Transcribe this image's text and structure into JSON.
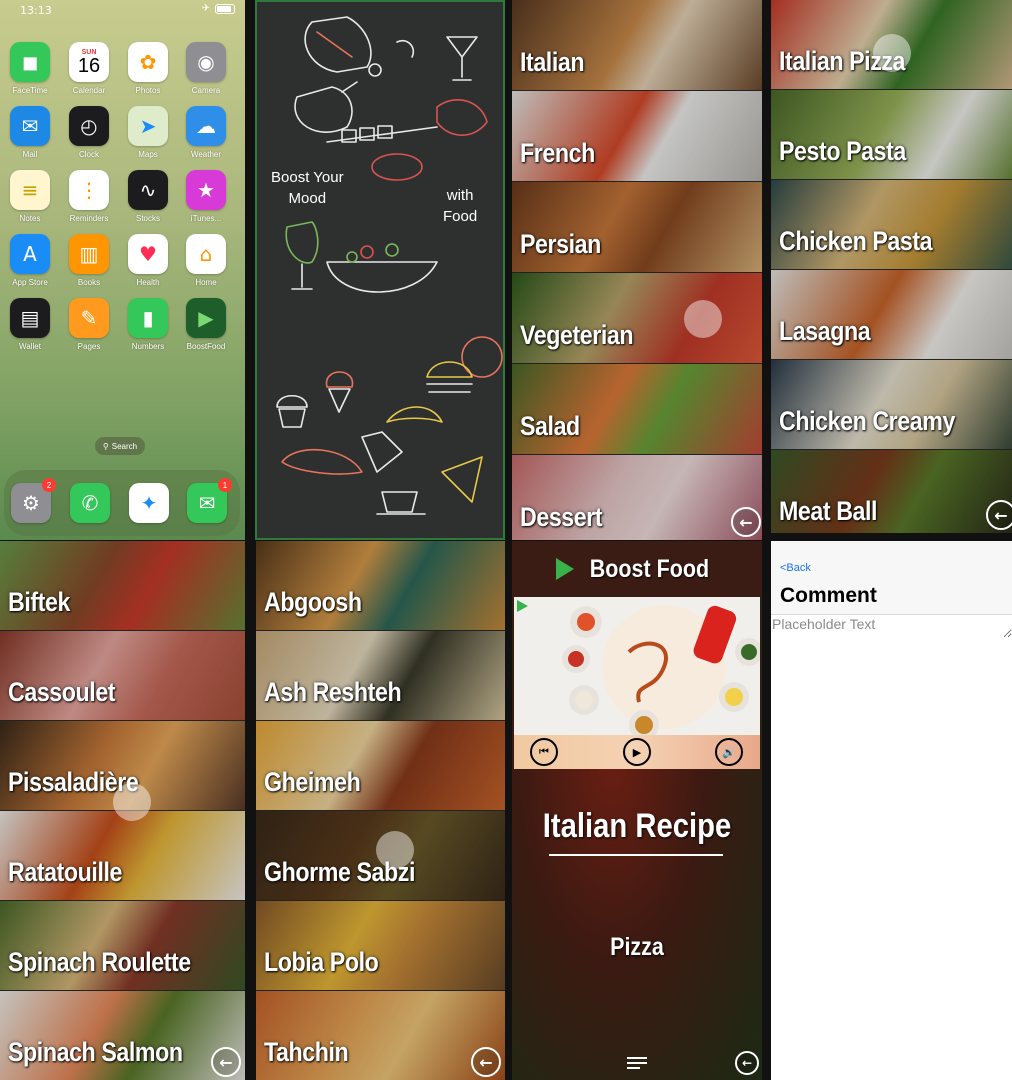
{
  "home": {
    "time": "13:13",
    "calendar_day": "SUN",
    "calendar_date": "16",
    "apps": [
      {
        "label": "FaceTime",
        "color": "#34c759",
        "icon": "video-icon",
        "glyph": "◼"
      },
      {
        "label": "Calendar",
        "color": "#ffffff",
        "icon": "calendar-icon",
        "glyph": ""
      },
      {
        "label": "Photos",
        "color": "#ffffff",
        "icon": "photos-icon",
        "glyph": "✿"
      },
      {
        "label": "Camera",
        "color": "#8e8e93",
        "icon": "camera-icon",
        "glyph": "◉"
      },
      {
        "label": "Mail",
        "color": "#1e88e5",
        "icon": "mail-icon",
        "glyph": "✉"
      },
      {
        "label": "Clock",
        "color": "#1c1c1e",
        "icon": "clock-icon",
        "glyph": "◴"
      },
      {
        "label": "Maps",
        "color": "#dfeccc",
        "icon": "maps-icon",
        "glyph": "➤"
      },
      {
        "label": "Weather",
        "color": "#2f8fe8",
        "icon": "weather-icon",
        "glyph": "☁"
      },
      {
        "label": "Notes",
        "color": "#fff6d0",
        "icon": "notes-icon",
        "glyph": "≡"
      },
      {
        "label": "Reminders",
        "color": "#ffffff",
        "icon": "reminders-icon",
        "glyph": "⋮"
      },
      {
        "label": "Stocks",
        "color": "#1c1c1e",
        "icon": "stocks-icon",
        "glyph": "∿"
      },
      {
        "label": "iTunes...",
        "color": "#d83ad8",
        "icon": "itunes-star-icon",
        "glyph": "★"
      },
      {
        "label": "App Store",
        "color": "#1a8cf5",
        "icon": "appstore-icon",
        "glyph": "A"
      },
      {
        "label": "Books",
        "color": "#ff9500",
        "icon": "books-icon",
        "glyph": "▥"
      },
      {
        "label": "Health",
        "color": "#ffffff",
        "icon": "health-heart-icon",
        "glyph": "♥"
      },
      {
        "label": "Home",
        "color": "#ffffff",
        "icon": "home-icon",
        "glyph": "⌂"
      },
      {
        "label": "Wallet",
        "color": "#1c1c1e",
        "icon": "wallet-icon",
        "glyph": "▤"
      },
      {
        "label": "Pages",
        "color": "#ff9a1f",
        "icon": "pages-icon",
        "glyph": "✎"
      },
      {
        "label": "Numbers",
        "color": "#34c759",
        "icon": "numbers-icon",
        "glyph": "▮"
      },
      {
        "label": "BoostFood",
        "color": "#1d5e2b",
        "icon": "boostfood-icon",
        "glyph": "▶"
      }
    ],
    "search_label": "Search",
    "dock": [
      {
        "icon": "settings-gear-icon",
        "color": "#8e8e93",
        "glyph": "⚙",
        "badge": "2"
      },
      {
        "icon": "phone-icon",
        "color": "#34c759",
        "glyph": "✆",
        "badge": ""
      },
      {
        "icon": "safari-compass-icon",
        "color": "#ffffff",
        "glyph": "✦",
        "badge": ""
      },
      {
        "icon": "messages-icon",
        "color": "#34c759",
        "glyph": "✉",
        "badge": "1"
      }
    ]
  },
  "splash": {
    "line1": "Boost Your",
    "line2": "Mood",
    "line3": "with",
    "line4": "Food"
  },
  "categories": {
    "items": [
      {
        "label": "Italian",
        "bg": "linear-gradient(120deg,#5a3a22,#c98a4a 45%,#e7d4b8 60%,#6e4a2c)"
      },
      {
        "label": "French",
        "bg": "linear-gradient(120deg,#e8e6e2,#d64a2a 45%,#f0f0ee 60%,#b8b6b0)"
      },
      {
        "label": "Persian",
        "bg": "linear-gradient(120deg,#6b3a1c,#c7773a 40%,#8a4a22 60%,#d9b27a)"
      },
      {
        "label": "Vegeterian",
        "bg": "linear-gradient(120deg,#2e5a1c,#b8a46a 40%,#c23a2a 70%,#e05a3a)"
      },
      {
        "label": "Salad",
        "bg": "linear-gradient(120deg,#4a6a2a,#e07a3a 40%,#6aa23a 60%,#c84a3a)"
      },
      {
        "label": "Dessert",
        "bg": "linear-gradient(120deg,#c86a6a,#e8c8c8 40%,#f2dede 60%,#a85a6a)"
      }
    ]
  },
  "italian": {
    "items": [
      {
        "label": "Italian Pizza",
        "bg": "linear-gradient(120deg,#c8392a,#e8d4b0 40%,#3a7a2a 60%,#d8b890)"
      },
      {
        "label": "Pesto Pasta",
        "bg": "linear-gradient(120deg,#4a6a2a,#9ab25a 45%,#f2f2ee 70%,#6a8a3a)"
      },
      {
        "label": "Chicken Pasta",
        "bg": "linear-gradient(120deg,#2e4a4a,#d8b87a 40%,#c8983a 65%,#3a5a4a)"
      },
      {
        "label": "Lasagna",
        "bg": "linear-gradient(120deg,#e8e6e2,#c8642a 45%,#f4f2ee 70%,#c8c6c0)"
      },
      {
        "label": "Chicken Creamy",
        "bg": "linear-gradient(120deg,#2a3a4a,#e8e2d0 45%,#d8c8a0 65%,#3a4a3a)"
      },
      {
        "label": "Meat Ball",
        "bg": "linear-gradient(120deg,#3a5a2a,#7a3a1c 40%,#5a7a2a 60%,#2a2a1a)"
      }
    ]
  },
  "french": {
    "items": [
      {
        "label": "Biftek",
        "bg": "linear-gradient(120deg,#6a9a4a,#8a4a2a 40%,#c83a2a 60%,#6a8a3a)"
      },
      {
        "label": "Cassoulet",
        "bg": "linear-gradient(120deg,#8a3a2a,#e8a8a0 40%,#c86a5a 65%,#a8503a)"
      },
      {
        "label": "Pissaladière",
        "bg": "linear-gradient(120deg,#3a2a1a,#c87a3a 40%,#e8a85a 60%,#5a3a2a)"
      },
      {
        "label": "Ratatouille",
        "bg": "linear-gradient(120deg,#f0eeea,#c8501c 40%,#e8b83a 60%,#f2f0ec)"
      },
      {
        "label": "Spinach Roulette",
        "bg": "linear-gradient(120deg,#4a6a2a,#d8b87a 40%,#8a3a2a 60%,#3a5a2a)"
      },
      {
        "label": "Spinach Salmon",
        "bg": "linear-gradient(120deg,#f0eee8,#e88a5a 40%,#5a7a2a 60%,#e8e6e0)"
      }
    ]
  },
  "persian": {
    "items": [
      {
        "label": "Abgoosh",
        "bg": "linear-gradient(120deg,#5a3a1c,#d89a4a 40%,#2e6a5a 60%,#c88a3a)"
      },
      {
        "label": "Ash Reshteh",
        "bg": "linear-gradient(120deg,#c8a878,#e8dcc0 40%,#3a3a2a 60%,#d8c8a0)"
      },
      {
        "label": "Gheimeh",
        "bg": "linear-gradient(120deg,#e8a83a,#f2d8a0 40%,#8a3a1c 60%,#c8642a)"
      },
      {
        "label": "Ghorme Sabzi",
        "bg": "linear-gradient(120deg,#3a2a1a,#5a3a1c 40%,#6a5a2a 60%,#3a2a1a)"
      },
      {
        "label": "Lobia Polo",
        "bg": "linear-gradient(120deg,#8a5a2a,#e8b83a 40%,#c88a3a 60%,#6a4a2a)"
      },
      {
        "label": "Tahchin",
        "bg": "linear-gradient(120deg,#c8642a,#e8a85a 40%,#f0c87a 60%,#a8501c)"
      }
    ]
  },
  "recipe": {
    "app_title": "Boost Food",
    "title": "Italian Recipe",
    "item": "Pizza"
  },
  "comment": {
    "back": "<Back",
    "title": "Comment",
    "placeholder": "Placeholder Text"
  }
}
